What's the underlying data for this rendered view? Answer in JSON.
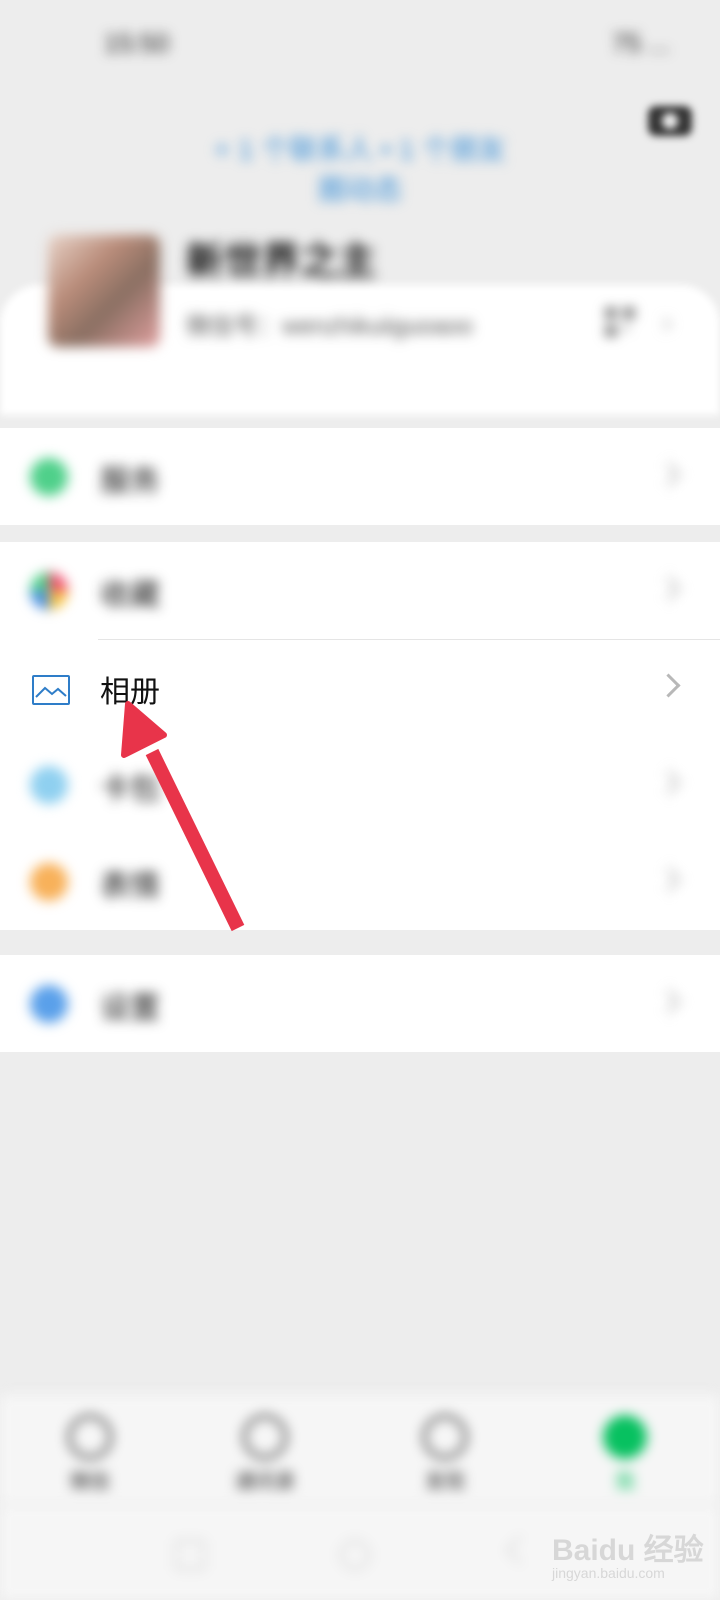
{
  "status_bar": {
    "time": "15:50",
    "right": "75 ..."
  },
  "top_banner": "+ 1 个联系人 • 1 个朋友圈动态",
  "profile": {
    "nickname": "新世界之主",
    "wechat_id": "微信号：wenzhikuiiguoaoo"
  },
  "menu": {
    "group1": [
      {
        "label": "服务",
        "icon": "service-icon"
      }
    ],
    "group2": [
      {
        "label": "收藏",
        "icon": "favorites-icon"
      },
      {
        "label": "相册",
        "icon": "album-icon"
      },
      {
        "label": "卡包",
        "icon": "cards-icon"
      },
      {
        "label": "表情",
        "icon": "sticker-icon"
      }
    ],
    "group3": [
      {
        "label": "设置",
        "icon": "settings-icon"
      }
    ]
  },
  "bottom_nav": {
    "tabs": [
      {
        "label": "微信",
        "icon": "chat-icon"
      },
      {
        "label": "通讯录",
        "icon": "contacts-icon"
      },
      {
        "label": "发现",
        "icon": "discover-icon"
      },
      {
        "label": "我",
        "icon": "me-icon",
        "active": true
      }
    ]
  },
  "watermark": {
    "brand": "Baidu 经验",
    "url": "jingyan.baidu.com"
  },
  "colors": {
    "accent_green": "#07c160",
    "arrow_red": "#e8344a",
    "album_blue": "#2e7dc8"
  }
}
